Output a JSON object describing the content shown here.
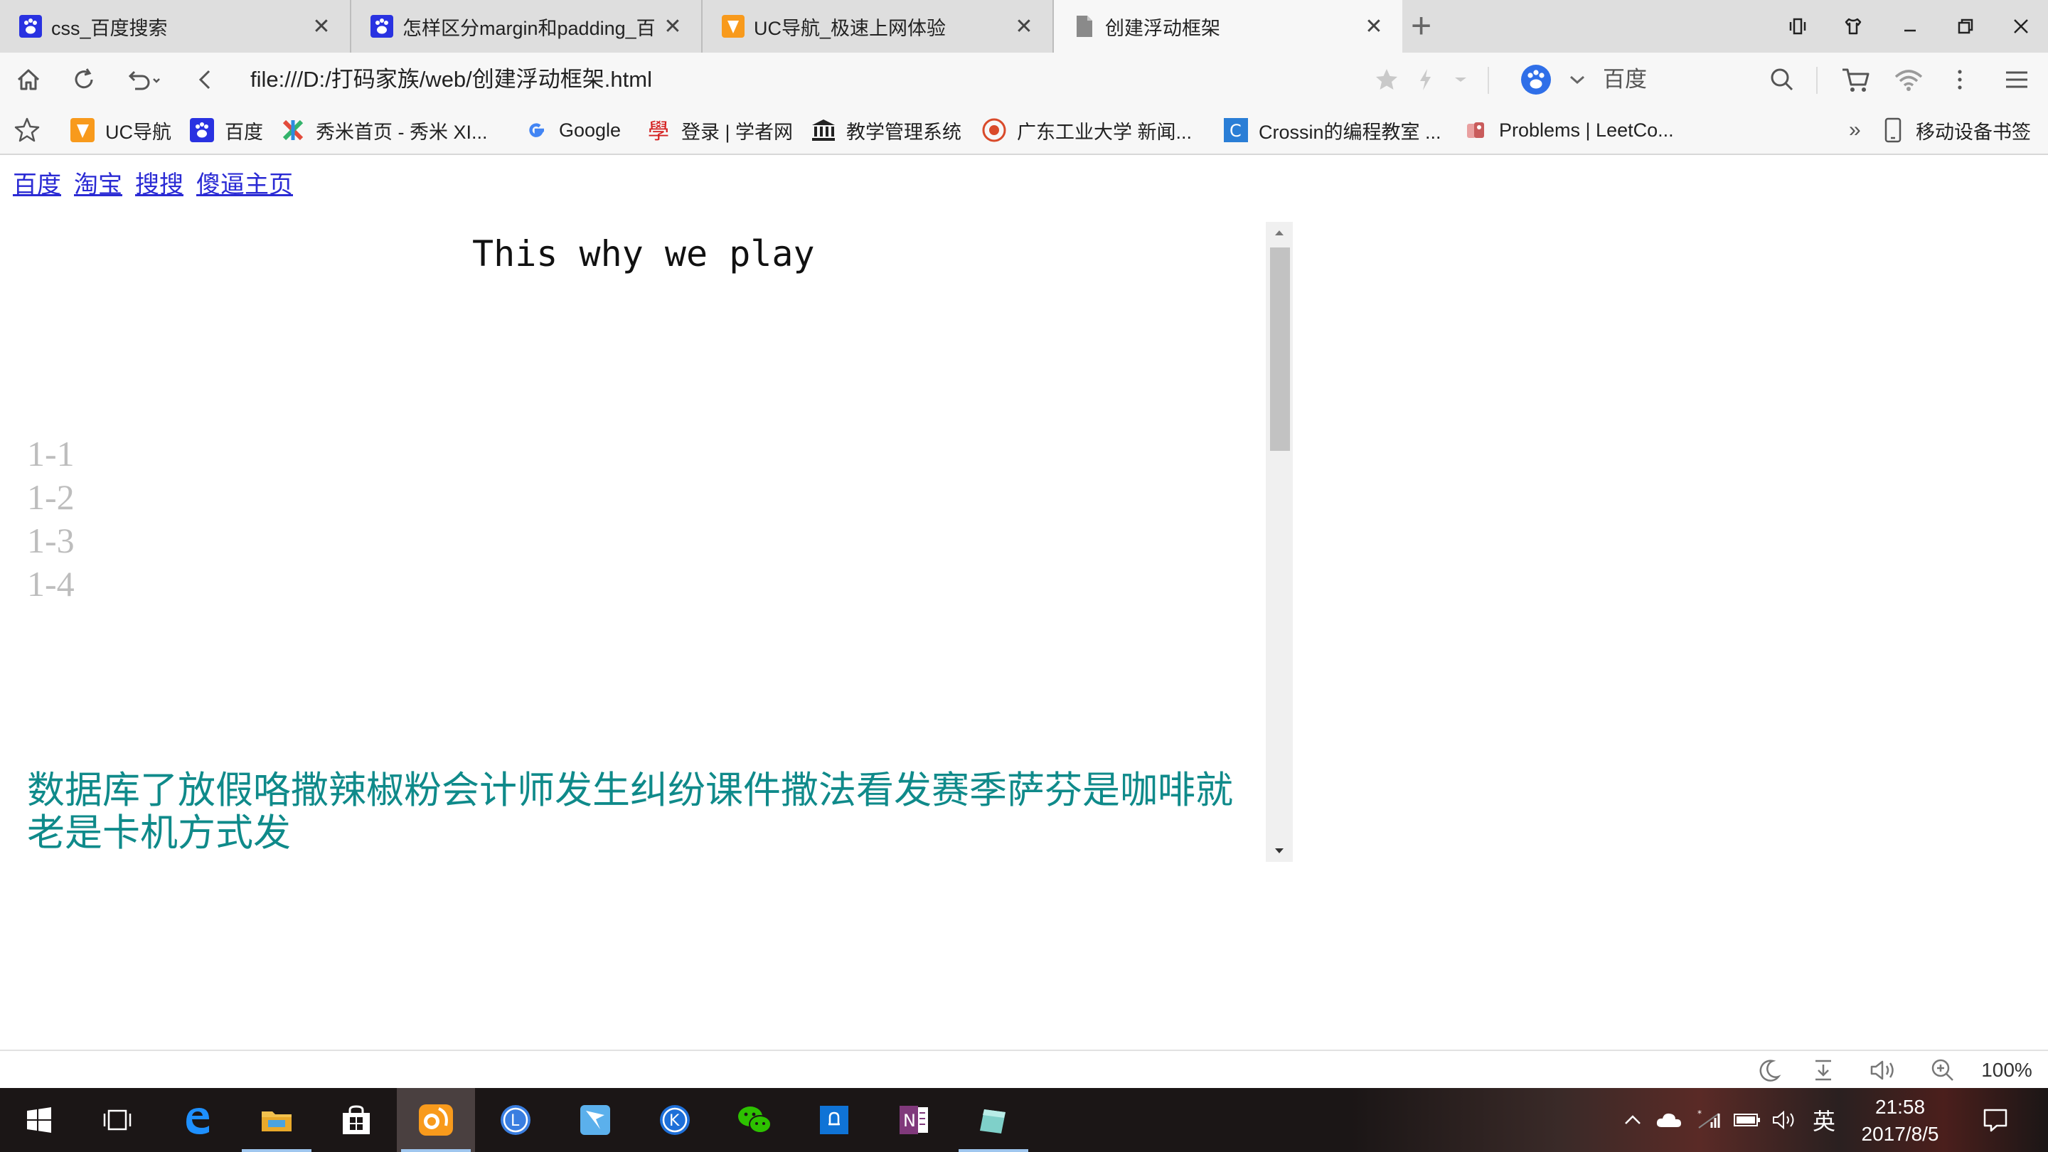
{
  "tabs": [
    {
      "title": "css_百度搜索",
      "favicon": "baidu-paw-icon",
      "active": false
    },
    {
      "title": "怎样区分margin和padding_百",
      "favicon": "baidu-paw-icon",
      "active": false
    },
    {
      "title": "UC导航_极速上网体验",
      "favicon": "uc-icon",
      "active": false
    },
    {
      "title": "创建浮动框架",
      "favicon": "document-icon",
      "active": true
    }
  ],
  "address_bar": {
    "url": "file:///D:/打码家族/web/创建浮动框架.html"
  },
  "search": {
    "engine": "百度",
    "engine_icon": "baidu-paw-icon"
  },
  "bookmarks": [
    {
      "label": "UC导航",
      "icon": "uc-icon"
    },
    {
      "label": "百度",
      "icon": "baidu-paw-icon"
    },
    {
      "label": "秀米首页 - 秀米 XI...",
      "icon": "xiumi-icon"
    },
    {
      "label": "Google",
      "icon": "google-icon"
    },
    {
      "label": "登录 | 学者网",
      "icon": "scholar-icon"
    },
    {
      "label": "教学管理系统",
      "icon": "building-icon"
    },
    {
      "label": "广东工业大学 新闻...",
      "icon": "gdut-icon"
    },
    {
      "label": "Crossin的编程教室 ...",
      "icon": "crossin-icon"
    },
    {
      "label": "Problems | LeetCo...",
      "icon": "leetcode-icon"
    }
  ],
  "bookmarks_more": "»",
  "mobile_bookmarks": "移动设备书签",
  "page": {
    "links": [
      "百度",
      "淘宝",
      "搜搜",
      "傻逼主页"
    ],
    "iframe": {
      "heading": "This why we play",
      "list": [
        "1-1",
        "1-2",
        "1-3",
        "1-4"
      ],
      "paragraph": "数据库了放假咯撒辣椒粉会计师发生纠纷课件撒法看发赛季萨芬是咖啡就老是卡机方式发"
    }
  },
  "status_bar": {
    "zoom": "100%"
  },
  "taskbar": {
    "apps": [
      "windows-start-icon",
      "task-view-icon",
      "edge-icon",
      "file-explorer-icon",
      "store-icon",
      "uc-browser-icon",
      "app-l-icon",
      "app-arrow-icon",
      "app-k-icon",
      "wechat-icon",
      "app-blue-square-icon",
      "onenote-icon",
      "notes-icon"
    ],
    "ime": "英",
    "time": "21:58",
    "date": "2017/8/5"
  },
  "colors": {
    "link": "#2a2ad4",
    "paragraph": "#0f8a8a",
    "list": "#bdbdbd",
    "baidu_blue": "#2932e1",
    "uc_orange": "#f89a1c"
  }
}
